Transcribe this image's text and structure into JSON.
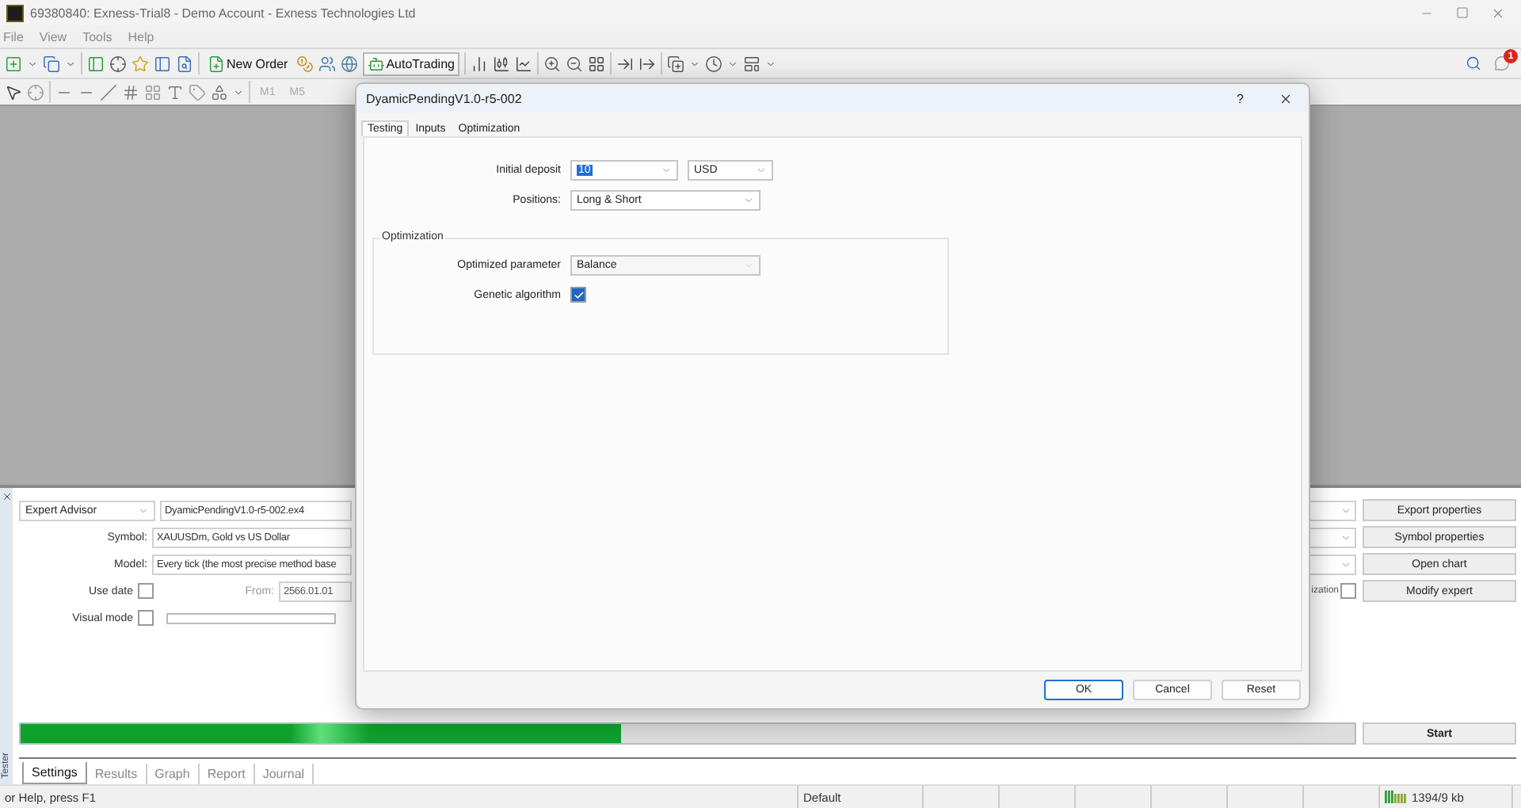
{
  "window": {
    "title": "69380840: Exness-Trial8 - Demo Account - Exness Technologies Ltd"
  },
  "menu": [
    "File",
    "View",
    "Tools",
    "Help"
  ],
  "toolbar": {
    "new_order": "New Order",
    "auto_trading": "AutoTrading"
  },
  "drawing_toolbar": {
    "periods": [
      "M1",
      "M5"
    ]
  },
  "notifications": {
    "badge": "1"
  },
  "tester": {
    "side_label": "Tester",
    "mode": "Expert Advisor",
    "expert": "DyamicPendingV1.0-r5-002.ex4",
    "symbol": {
      "label": "Symbol:",
      "value": "XAUUSDm, Gold vs US Dollar"
    },
    "model": {
      "label": "Model:",
      "value": "Every tick (the most precise method base"
    },
    "use_date": {
      "label": "Use date",
      "checked": false
    },
    "from": {
      "label": "From:",
      "value": "2566.01.01"
    },
    "visual_mode": {
      "label": "Visual mode",
      "checked": false
    },
    "optimization": {
      "label": "ization",
      "checked": false
    },
    "buttons": [
      "Export properties",
      "Symbol properties",
      "Open chart",
      "Modify expert"
    ],
    "progress": {
      "level": 0.45
    },
    "start": "Start",
    "tabs": [
      {
        "label": "Settings",
        "selected": true
      },
      {
        "label": "Results",
        "selected": false
      },
      {
        "label": "Graph",
        "selected": false
      },
      {
        "label": "Report",
        "selected": false
      },
      {
        "label": "Journal",
        "selected": false
      }
    ]
  },
  "dialog": {
    "title": "DyamicPendingV1.0-r5-002",
    "help": "?",
    "tabs": [
      {
        "label": "Testing",
        "selected": true
      },
      {
        "label": "Inputs",
        "selected": false
      },
      {
        "label": "Optimization",
        "selected": false
      }
    ],
    "initial_deposit": {
      "label": "Initial deposit",
      "value": "10",
      "currency": "USD"
    },
    "positions": {
      "label": "Positions:",
      "value": "Long & Short"
    },
    "group": {
      "title": "Optimization",
      "parameter": {
        "label": "Optimized parameter",
        "value": "Balance",
        "disabled": true
      },
      "genetic": {
        "label": "Genetic algorithm",
        "checked": true
      }
    },
    "buttons": [
      {
        "label": "OK",
        "focused": true
      },
      {
        "label": "Cancel",
        "focused": false
      },
      {
        "label": "Reset",
        "focused": false
      }
    ]
  },
  "status_bar": {
    "hint": "or Help, press F1",
    "profile": "Default",
    "traffic": "1394/9 kb"
  }
}
